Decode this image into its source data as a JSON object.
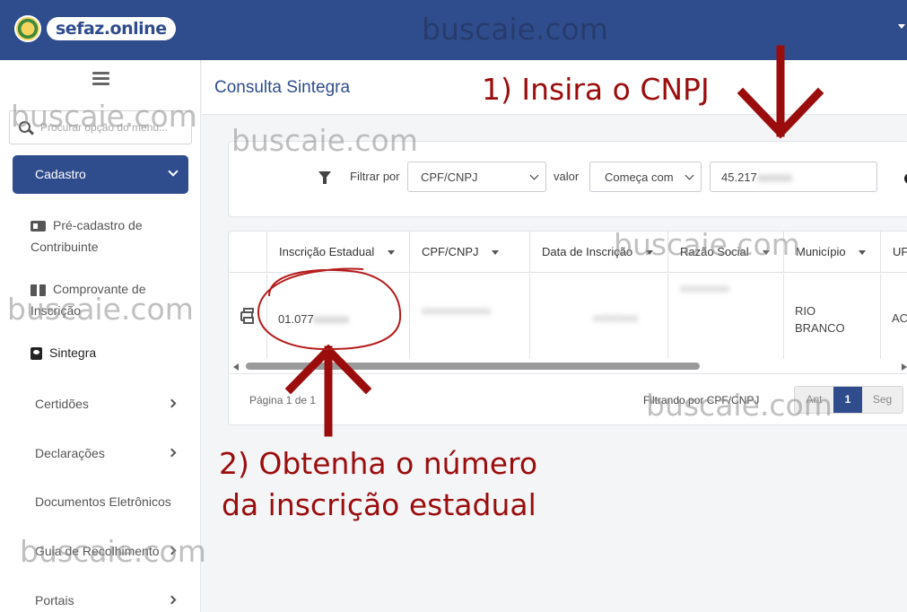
{
  "header": {
    "logo_text": "sefaz.online"
  },
  "sidebar": {
    "search_placeholder": "Procurar opção do menu...",
    "cadastro_label": "Cadastro",
    "sub_items": [
      {
        "line1": "Pré-cadastro de",
        "line2": "Contribuinte",
        "icon": "id-card-icon"
      },
      {
        "line1": "Comprovante de",
        "line2": "Inscrição",
        "icon": "book-icon"
      },
      {
        "line1": "Sintegra",
        "icon": "registration-icon"
      }
    ],
    "menu_items": [
      {
        "label": "Certidões",
        "has_arrow": true
      },
      {
        "label": "Declarações",
        "has_arrow": true
      },
      {
        "label": "Documentos Eletrônicos",
        "has_arrow": false
      },
      {
        "label": "Guia de Recolhimento",
        "has_arrow": true
      },
      {
        "label": "Portais",
        "has_arrow": true
      }
    ]
  },
  "page": {
    "title": "Consulta Sintegra"
  },
  "filter": {
    "filter_by_label": "Filtrar por",
    "field_value": "CPF/CNPJ",
    "value_label": "valor",
    "operator_value": "Começa com",
    "input_prefix": "45.217",
    "input_hidden": "xxxxxx"
  },
  "grid": {
    "columns": [
      "Inscrição Estadual",
      "CPF/CNPJ",
      "Data de Inscrição",
      "Razão Social",
      "Município",
      "UF"
    ],
    "row": {
      "inscricao_prefix": "01.077",
      "inscricao_hidden": "xxxxxx",
      "cnpj_hidden": "xxxxxxxxxxxxxx",
      "data_hidden": "xx/xx/xxxx",
      "razao_hidden": "xxxxxxxxxx",
      "municipio": "RIO BRANCO",
      "uf": "AC"
    },
    "page_info": "Página 1 de 1",
    "filtering_label": "Filtrando por CPF/CNPJ",
    "pager": {
      "prev": "Ant",
      "current": "1",
      "next": "Seg"
    }
  },
  "annotations": {
    "step1": "1) Insira o CNPJ",
    "step2_line1": "2) Obtenha o número",
    "step2_line2": "da inscrição estadual",
    "color": "#9b0d0d"
  },
  "watermark": "buscaie.com",
  "colors": {
    "brand": "#2f4d8d"
  }
}
